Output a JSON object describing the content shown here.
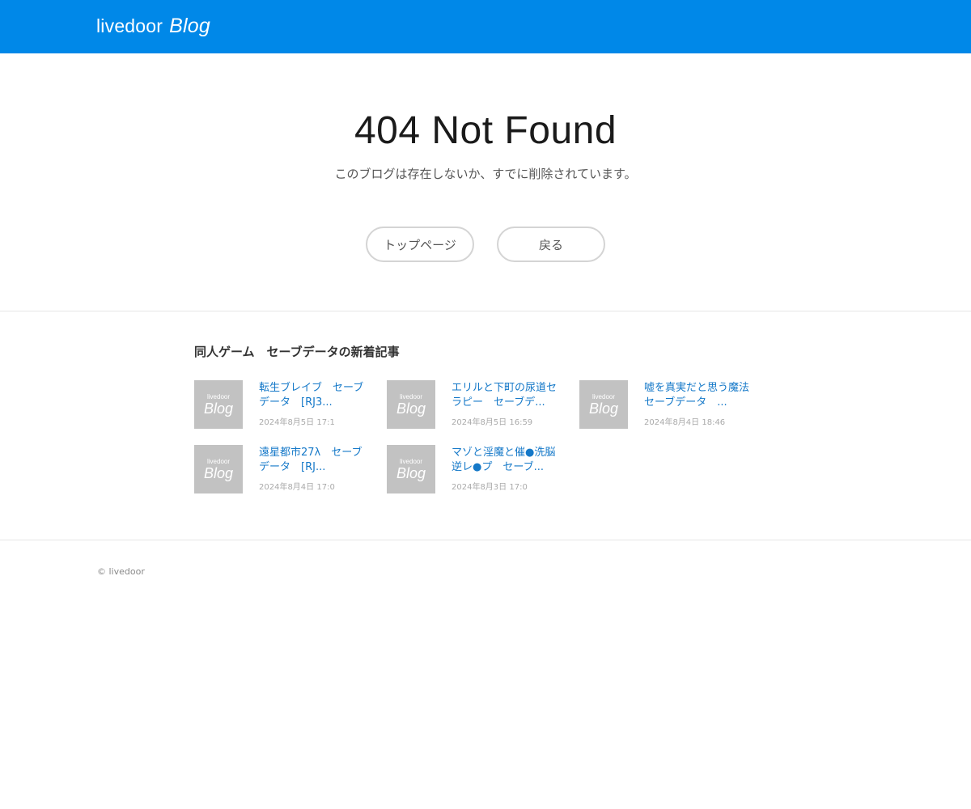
{
  "header": {
    "logo_text": "livedoor",
    "logo_emphasis": "Blog",
    "background_color": "#0088e8"
  },
  "main": {
    "title": "404 Not Found",
    "message": "このブログは存在しないか、すでに削除されています。",
    "buttons": {
      "top_page": "トップページ",
      "back": "戻る"
    }
  },
  "recent": {
    "heading": "同人ゲーム　セーブデータの新着記事",
    "thumbnail": {
      "small": "livedoor",
      "big": "Blog"
    },
    "articles": [
      {
        "title": "転生ブレイブ　セーブデータ　[RJ3...",
        "date": "2024年8月5日 17:1"
      },
      {
        "title": "エリルと下町の尿道セラピー　セーブデ...",
        "date": "2024年8月5日 16:59"
      },
      {
        "title": "嘘を真実だと思う魔法　セーブデータ　...",
        "date": "2024年8月4日 18:46"
      },
      {
        "title": "遠星都市27λ　セーブデータ　[RJ...",
        "date": "2024年8月4日 17:0"
      },
      {
        "title": "マゾと淫魔と催●洗脳逆レ●プ　セーブ...",
        "date": "2024年8月3日 17:0"
      }
    ],
    "title_color": "#1478c8"
  },
  "footer": {
    "copyright": "© livedoor"
  }
}
